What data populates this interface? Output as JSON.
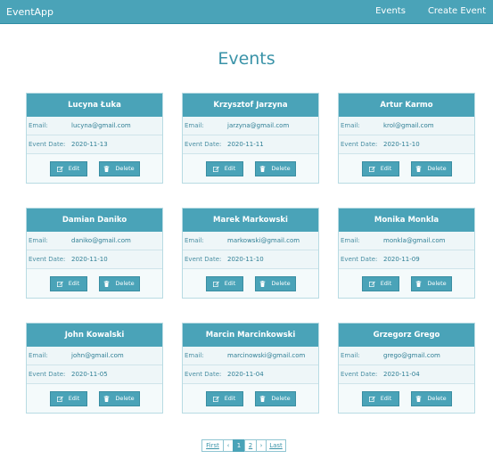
{
  "navbar": {
    "brand": "EventApp",
    "links": [
      "Events",
      "Create Event"
    ]
  },
  "page": {
    "title": "Events"
  },
  "labels": {
    "email": "Email:",
    "event_date": "Event Date:",
    "edit": "Edit",
    "delete": "Delete"
  },
  "events": [
    {
      "name": "Lucyna Łuka",
      "email": "lucyna@gmail.com",
      "date": "2020-11-13"
    },
    {
      "name": "Krzysztof Jarzyna",
      "email": "jarzyna@gmail.com",
      "date": "2020-11-11"
    },
    {
      "name": "Artur Karmo",
      "email": "krol@gmail.com",
      "date": "2020-11-10"
    },
    {
      "name": "Damian Daniko",
      "email": "daniko@gmail.com",
      "date": "2020-11-10"
    },
    {
      "name": "Marek Markowski",
      "email": "markowski@gmail.com",
      "date": "2020-11-10"
    },
    {
      "name": "Monika Monkla",
      "email": "monkla@gmail.com",
      "date": "2020-11-09"
    },
    {
      "name": "John Kowalski",
      "email": "john@gmail.com",
      "date": "2020-11-05"
    },
    {
      "name": "Marcin Marcinkowski",
      "email": "marcinowski@gmail.com",
      "date": "2020-11-04"
    },
    {
      "name": "Grzegorz Grego",
      "email": "grego@gmail.com",
      "date": "2020-11-04"
    }
  ],
  "pagination": {
    "first": "First",
    "prev": "‹",
    "pages": [
      "1",
      "2"
    ],
    "current": "1",
    "next": "›",
    "last": "Last"
  },
  "colors": {
    "accent": "#4aa3b8",
    "accent_text": "#3a93a8"
  },
  "icons": {
    "edit": "edit-icon",
    "delete": "trash-icon"
  }
}
